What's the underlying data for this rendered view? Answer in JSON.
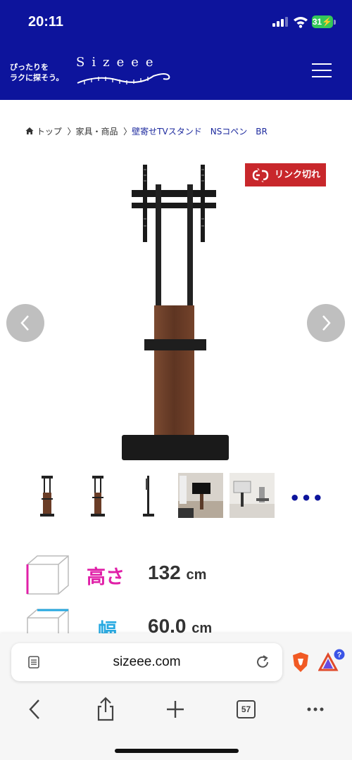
{
  "status": {
    "time": "20:11",
    "battery": "31"
  },
  "header": {
    "tagline_line1": "ぴったりを",
    "tagline_line2": "ラクに探そう。",
    "logo": "Sizeee",
    "bg_color": "#0d149c"
  },
  "breadcrumb": {
    "items": [
      "トップ",
      "家具・商品"
    ],
    "current": "壁寄せTVスタンド　NSコペン　BR"
  },
  "product": {
    "badge": "リンク切れ",
    "badge_color": "#c8272b",
    "more_thumbs": "•••"
  },
  "dimensions": [
    {
      "label": "高さ",
      "value": "132",
      "unit": "cm",
      "color": "#e020a8"
    },
    {
      "label": "幅",
      "value": "60.0",
      "unit": "cm",
      "color": "#27a9e1"
    }
  ],
  "browser": {
    "url": "sizeee.com",
    "tab_count": "57",
    "notification_badge": "?"
  }
}
